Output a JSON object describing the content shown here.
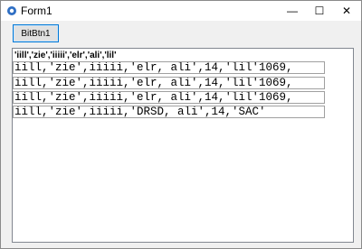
{
  "window": {
    "title": "Form1",
    "minimize_glyph": "—",
    "maximize_glyph": "☐",
    "close_glyph": "✕"
  },
  "toolbar": {
    "bitbtn_label": "BitBtn1"
  },
  "list": {
    "header": "'iill','zie','iiiii','elr','ali','lil'",
    "rows": [
      "iill,'zie',iiiii,'elr, ali',14,'lil'1069,",
      "iill,'zie',iiiii,'elr, ali',14,'lil'1069,",
      "iill,'zie',iiiii,'elr, ali',14,'lil'1069,",
      "iill,'zie',iiiii,'DRSD, ali',14,'SAC'"
    ]
  }
}
